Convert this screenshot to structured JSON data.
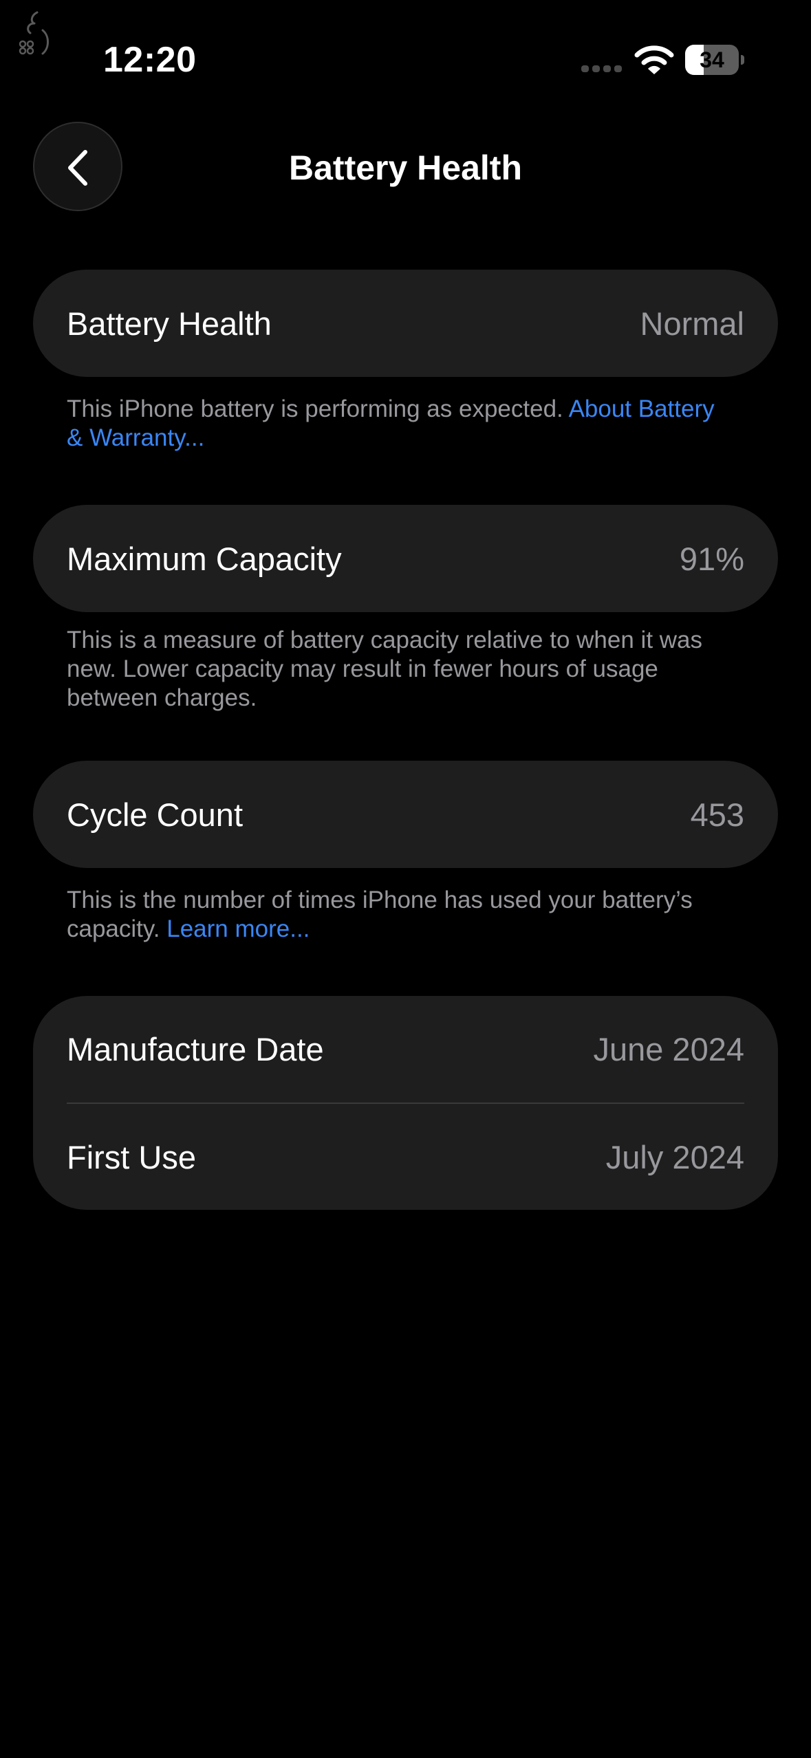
{
  "status_bar": {
    "time": "12:20",
    "battery_level": "34",
    "battery_fraction": 0.34,
    "icons": [
      "corner-glyph",
      "cellular-signal-icon",
      "wifi-icon",
      "battery-icon"
    ]
  },
  "nav": {
    "back_icon": "chevron-left-icon",
    "title": "Battery Health"
  },
  "battery_health": {
    "label": "Battery Health",
    "value": "Normal",
    "footnote_text": "This iPhone battery is performing as expected. ",
    "footnote_link": "About Battery & Warranty..."
  },
  "maximum_capacity": {
    "label": "Maximum Capacity",
    "value": "91%",
    "footnote_text": "This is a measure of battery capacity relative to when it was new. Lower capacity may result in fewer hours of usage between charges."
  },
  "cycle_count": {
    "label": "Cycle Count",
    "value": "453",
    "footnote_text": "This is the number of times iPhone has used your battery’s capacity. ",
    "footnote_link": "Learn more..."
  },
  "dates": {
    "manufacture_label": "Manufacture Date",
    "manufacture_value": "June 2024",
    "first_use_label": "First Use",
    "first_use_value": "July 2024"
  },
  "colors": {
    "background": "#000000",
    "cell_background": "#1e1e1e",
    "secondary_text": "#98989d",
    "link": "#3a86f5"
  }
}
